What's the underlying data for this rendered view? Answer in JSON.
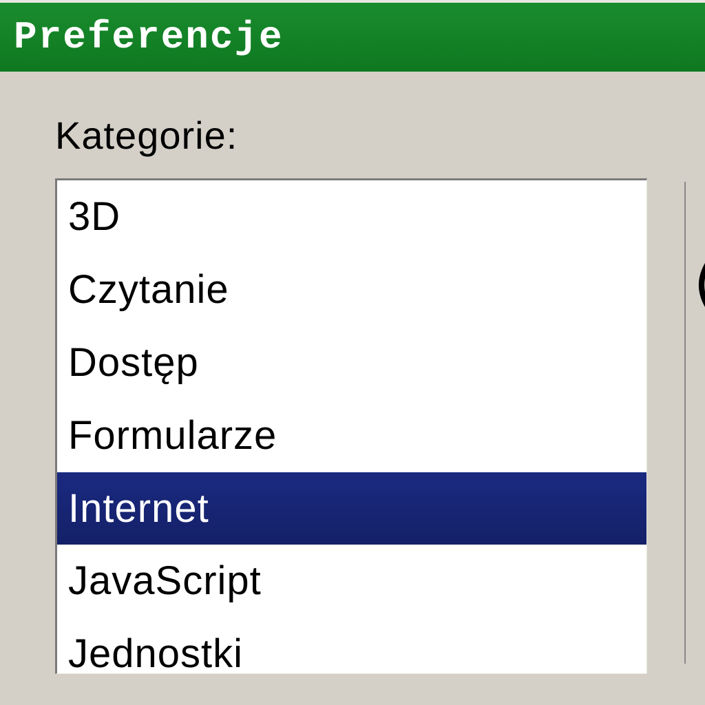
{
  "window": {
    "title": "Preferencje"
  },
  "categories": {
    "label": "Kategorie:",
    "items": [
      {
        "label": "3D",
        "selected": false
      },
      {
        "label": "Czytanie",
        "selected": false
      },
      {
        "label": "Dostęp",
        "selected": false
      },
      {
        "label": "Formularze",
        "selected": false
      },
      {
        "label": "Internet",
        "selected": true
      },
      {
        "label": "JavaScript",
        "selected": false
      },
      {
        "label": "Jednostki",
        "selected": false
      }
    ]
  },
  "colors": {
    "titlebar_bg": "#108a28",
    "selection_bg": "#1a2a80",
    "window_bg": "#d4d0c8"
  }
}
